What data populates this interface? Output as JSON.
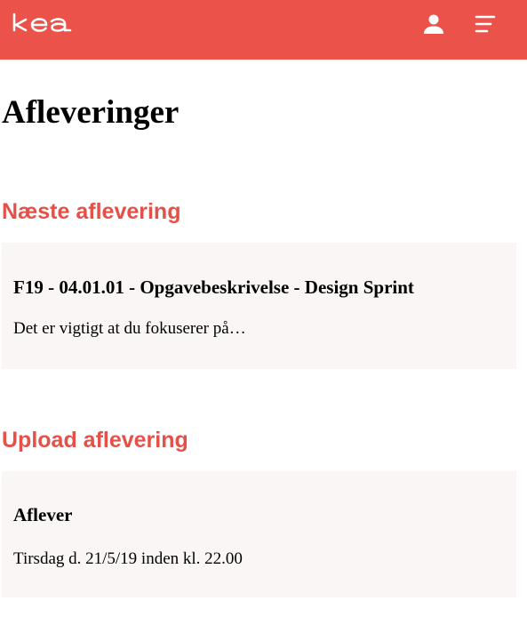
{
  "header": {
    "logo_text": "kea",
    "icons": [
      "user-icon",
      "menu-icon"
    ],
    "brand_color": "#ea524a"
  },
  "page": {
    "title": "Afleveringer"
  },
  "next_assignment": {
    "heading": "Næste aflevering",
    "card": {
      "title": "F19 - 04.01.01 - Opgavebeskrivelse - Design Sprint",
      "description": "Det er vigtigt at du fokuserer på…"
    }
  },
  "upload": {
    "heading": "Upload aflevering",
    "card": {
      "title": "Aflever",
      "deadline": "Tirsdag d. 21/5/19 inden kl. 22.00"
    }
  },
  "colors": {
    "accent": "#e45148",
    "card_background": "#f9f6f5"
  }
}
